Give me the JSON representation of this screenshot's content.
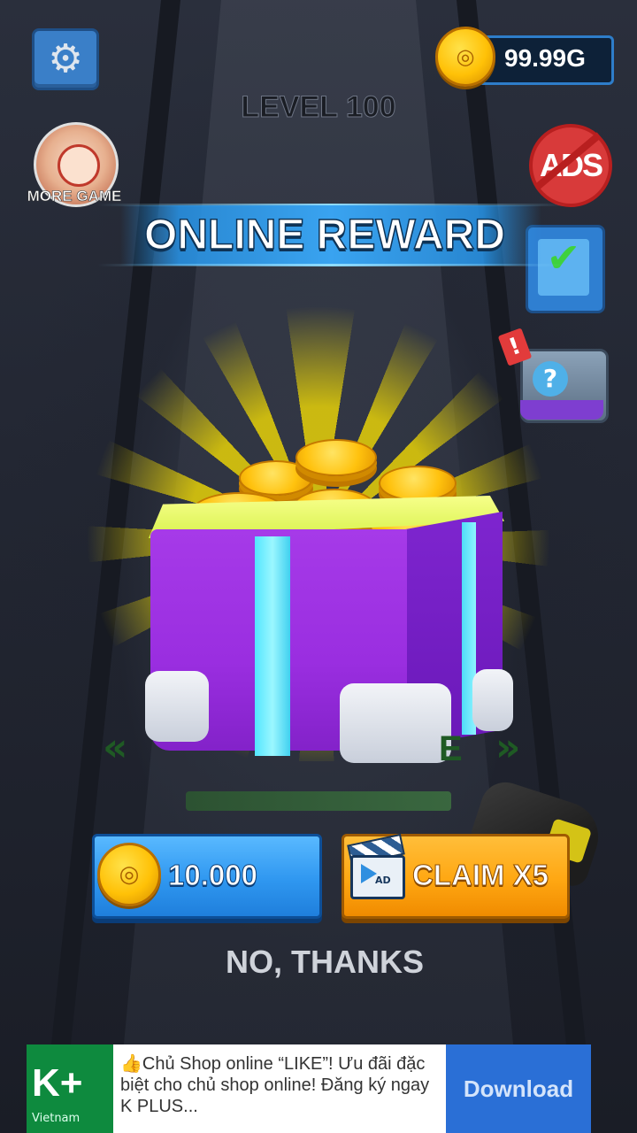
{
  "hud": {
    "coins": "99.99G",
    "level": "LEVEL 100",
    "more_game_label": "MORE GAME",
    "no_ads_label": "ADS"
  },
  "popup": {
    "title": "ONLINE REWARD",
    "reward_amount": "10.000",
    "claim_label": "CLAIM X5",
    "claim_icon_label": "AD",
    "decline_label": "NO, THANKS"
  },
  "ad_banner": {
    "brand": "K+",
    "brand_sub": "Vietnam",
    "text": "👍Chủ Shop online “LIKE”! Ưu đãi đặc biệt cho chủ shop online! Đăng ký ngay K PLUS...",
    "cta": "Download"
  },
  "icons": {
    "settings": "gear-icon",
    "currency": "coin-icon",
    "tasks": "clipboard-check-icon",
    "mystery": "mystery-box-icon",
    "reward": "gift-box-icon",
    "video_ad": "clapperboard-icon"
  },
  "colors": {
    "banner": "#39a3f0",
    "gift_box": "#9a2ee0",
    "ribbon": "#52e6ff",
    "coin_button": "#2f97f0",
    "claim_button": "#ffa712"
  }
}
